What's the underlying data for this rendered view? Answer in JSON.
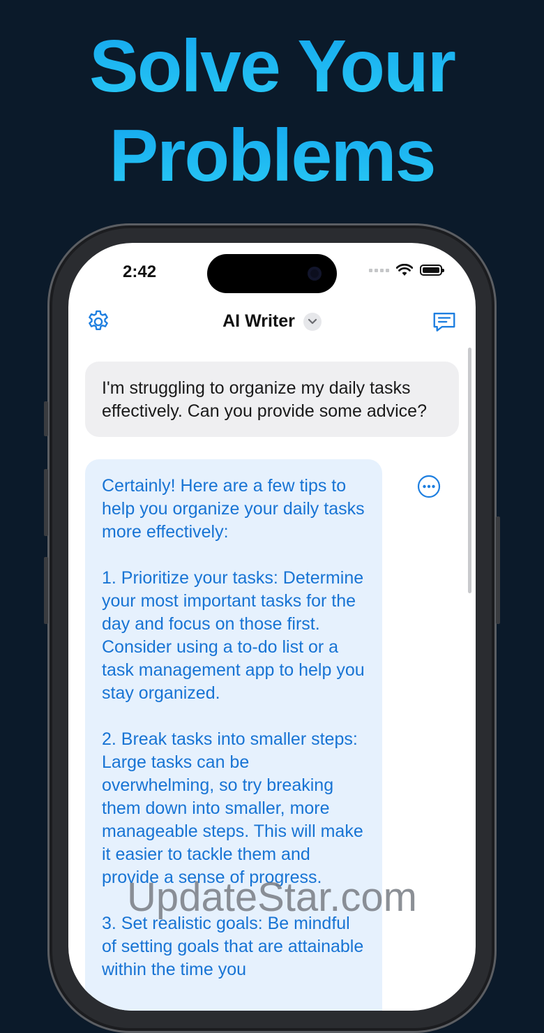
{
  "headline": {
    "line1": "Solve Your",
    "line2": "Problems"
  },
  "status_bar": {
    "time": "2:42"
  },
  "nav": {
    "title": "AI Writer"
  },
  "chat": {
    "user_message": "I'm struggling to organize my daily tasks effectively. Can you provide some advice?",
    "ai_message": "Certainly! Here are a few tips to help you organize your daily tasks more effectively:\n\n1. Prioritize your tasks: Determine your most important tasks for the day and focus on those first. Consider using a to-do list or a task management app to help you stay organized.\n\n2. Break tasks into smaller steps: Large tasks can be overwhelming, so try breaking them down into smaller, more manageable steps. This will make it easier to tackle them and provide a sense of progress.\n\n3. Set realistic goals: Be mindful of setting goals that are attainable within the time you"
  },
  "watermark": "UpdateStar.com",
  "icons": {
    "settings": "gear-icon",
    "dropdown": "chevron-down-icon",
    "new_chat": "compose-chat-icon",
    "more": "more-options-icon",
    "wifi": "wifi-icon",
    "battery": "battery-icon"
  },
  "colors": {
    "background": "#0b1a2a",
    "headline": "#1fb2f0",
    "accent": "#1874d4",
    "ai_bubble": "#e6f1fd",
    "user_bubble": "#efeff1"
  }
}
